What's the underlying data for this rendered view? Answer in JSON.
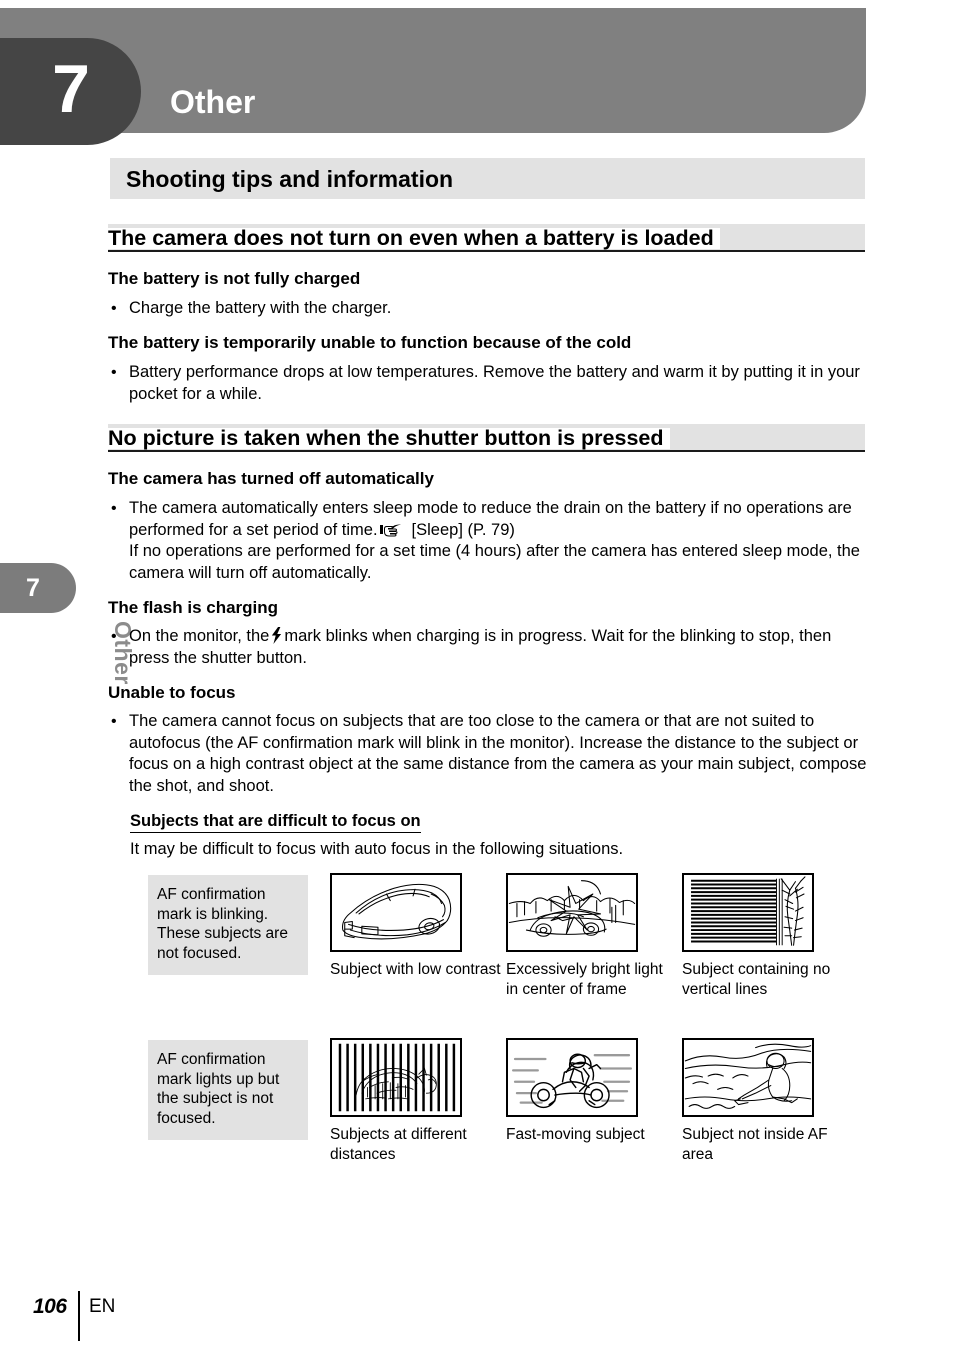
{
  "chapter": {
    "number": "7",
    "title": "Other"
  },
  "side_tab": {
    "number": "7",
    "label": "Other"
  },
  "section": {
    "banner_title": "Shooting tips and information"
  },
  "headings": {
    "h2_battery": "The camera does not turn on even when a battery is loaded",
    "h2_nopicture": "No picture is taken when the shutter button is pressed"
  },
  "blocks": {
    "battery_not_charged": {
      "subhead": "The battery is not fully charged",
      "bullet": "Charge the battery with the charger."
    },
    "battery_cold": {
      "subhead": "The battery is temporarily unable to function because of the cold",
      "bullet": "Battery performance drops at low temperatures. Remove the battery and warm it by putting it in your pocket for a while."
    },
    "turned_off": {
      "subhead": "The camera has turned off automatically",
      "bullet_part1": "The camera automatically enters sleep mode to reduce the drain on the battery if no operations are performed for a set period of time.",
      "bullet_ref": "[Sleep] (P. 79)",
      "bullet_part2": "If no operations are performed for a set time (4 hours) after the camera has entered sleep mode, the camera will turn off automatically."
    },
    "flash_charging": {
      "subhead": "The flash is charging",
      "bullet_part1": "On the monitor, the",
      "bullet_part2": "mark blinks when charging is in progress. Wait for the blinking to stop, then press the shutter button."
    },
    "unable_to_focus": {
      "subhead": "Unable to focus",
      "bullet": "The camera cannot focus on subjects that are too close to the camera or that are not suited to autofocus (the AF confirmation mark will blink in the monitor). Increase the distance to the subject or focus on a high contrast object at the same distance from the camera as your main subject, compose the shot, and shoot.",
      "h4": "Subjects that are difficult to focus on",
      "intro": "It may be difficult to focus with auto focus in the following situations."
    }
  },
  "figure_table": {
    "rows": [
      {
        "note": "AF confirmation mark is blinking. These subjects are not focused.",
        "cells": [
          {
            "caption": "Subject with low contrast",
            "image": "car-low-contrast-illustration"
          },
          {
            "caption": "Excessively bright light in center of frame",
            "image": "car-bright-light-illustration"
          },
          {
            "caption": "Subject containing no vertical lines",
            "image": "horizontal-blinds-illustration"
          }
        ]
      },
      {
        "note": "AF confirmation mark lights up but the subject is not focused.",
        "cells": [
          {
            "caption": "Subjects at different distances",
            "image": "animal-behind-fence-illustration"
          },
          {
            "caption": "Fast-moving subject",
            "image": "motorcycle-illustration"
          },
          {
            "caption": "Subject not inside AF area",
            "image": "person-off-center-illustration"
          }
        ]
      }
    ]
  },
  "footer": {
    "page_number": "106",
    "language": "EN"
  },
  "colors": {
    "header_band": "#808080",
    "header_numbox": "#454545",
    "banner_gray": "#e2e2e2",
    "side_tab": "#7c7c7c",
    "side_tab_label": "#8c8c8c"
  },
  "icons": {
    "reference_hand": "pointing-hand-icon",
    "flash": "flash-bolt-icon"
  }
}
